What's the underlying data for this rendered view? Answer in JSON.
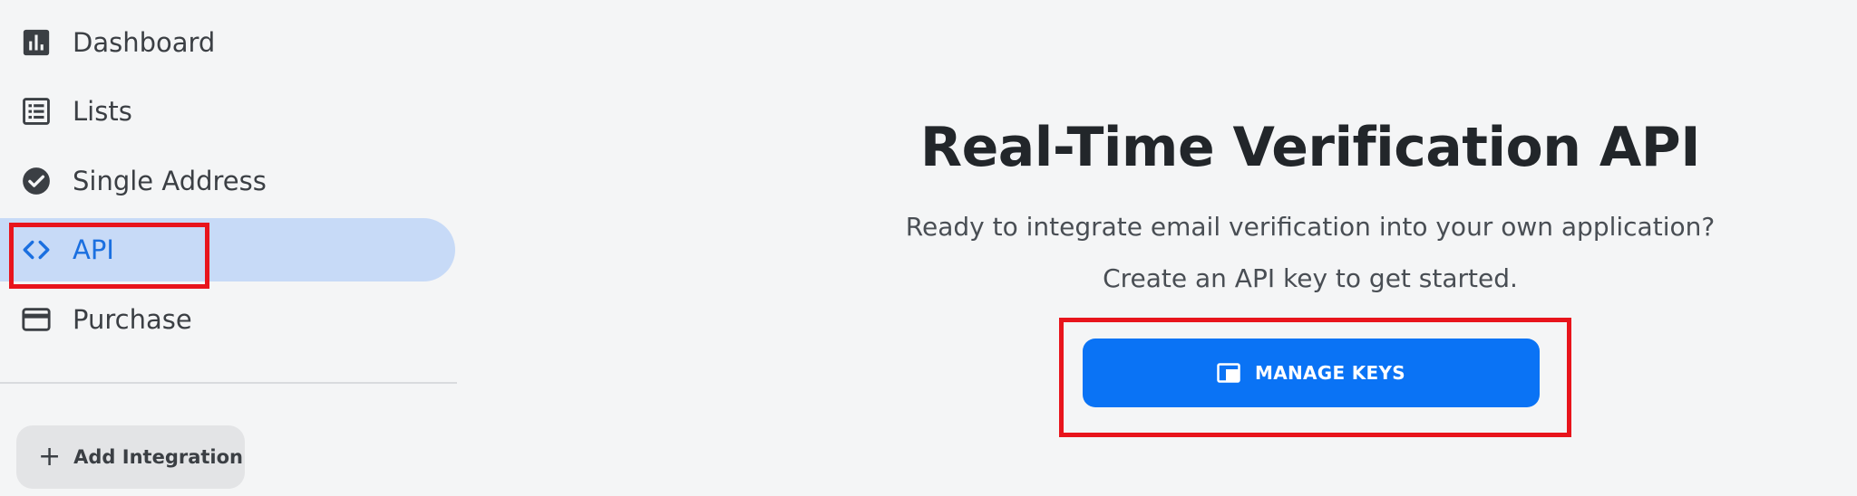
{
  "sidebar": {
    "items": [
      {
        "label": "Dashboard",
        "icon": "bar-chart-icon"
      },
      {
        "label": "Lists",
        "icon": "list-icon"
      },
      {
        "label": "Single Address",
        "icon": "check-circle-icon"
      },
      {
        "label": "API",
        "icon": "code-icon",
        "active": true
      },
      {
        "label": "Purchase",
        "icon": "credit-card-icon"
      }
    ],
    "add_integration": {
      "label": "Add Integration",
      "icon": "plus-icon"
    }
  },
  "main": {
    "title": "Real-Time Verification API",
    "subtitle_line1": "Ready to integrate email verification into your own application?",
    "subtitle_line2": "Create an API key to get started.",
    "manage_button": {
      "label": "MANAGE KEYS",
      "icon": "folder-icon"
    }
  },
  "colors": {
    "background": "#f4f5f6",
    "accent": "#0a73f5",
    "active_nav_bg": "#c7daf7",
    "active_nav_text": "#1a6fe0",
    "highlight": "#e8141c"
  }
}
